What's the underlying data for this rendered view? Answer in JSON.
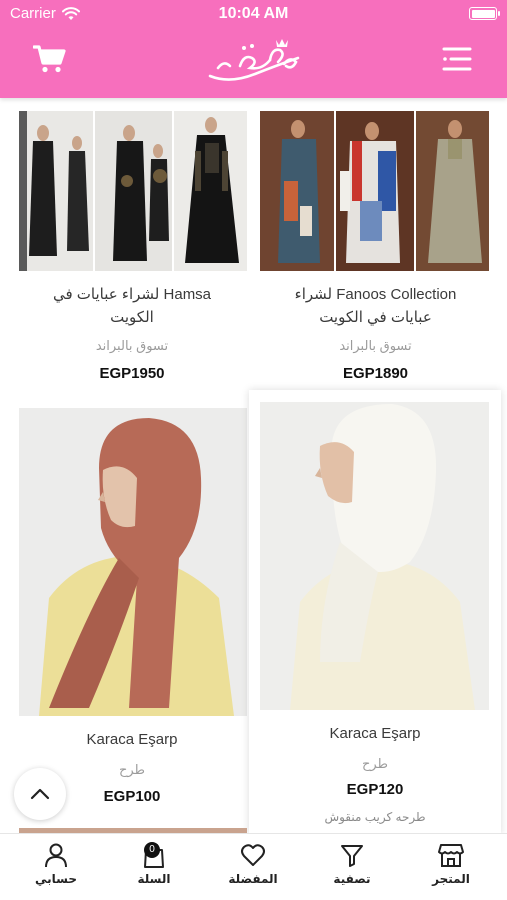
{
  "status_bar": {
    "carrier": "Carrier",
    "time": "10:04 AM"
  },
  "header": {
    "logo_text": "نعومي مول",
    "accent_color": "#f76fbd"
  },
  "products": [
    {
      "title_line1": "Hamsa لشراء عبايات في",
      "title_line2": "الكويت",
      "subtitle": "تسوق بالبراند",
      "price": "EGP1950"
    },
    {
      "title_line1": "Fanoos Collection لشراء",
      "title_line2": "عبايات في الكويت",
      "subtitle": "تسوق بالبراند",
      "price": "EGP1890"
    },
    {
      "title": "Karaca Eşarp",
      "subtitle": "طرح",
      "price": "EGP100"
    },
    {
      "title": "Karaca Eşarp",
      "subtitle": "طرح",
      "price": "EGP120",
      "description": "طرحه كريب منقوش"
    }
  ],
  "tabbar": {
    "account": "حسابي",
    "cart": "السلة",
    "cart_badge": "0",
    "favorites": "المفضلة",
    "filter": "تصفية",
    "store": "المتجر"
  }
}
